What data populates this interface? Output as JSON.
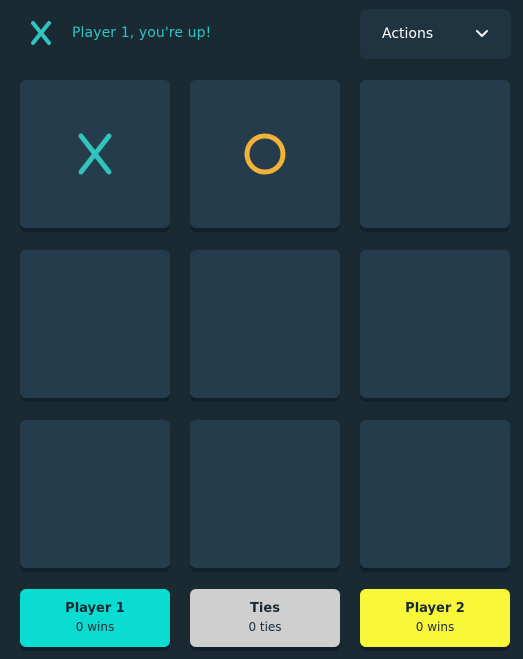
{
  "header": {
    "turn_mark": "X",
    "turn_text": "Player 1, you're up!",
    "actions_label": "Actions"
  },
  "board": {
    "cells": [
      "X",
      "O",
      "",
      "",
      "",
      "",
      "",
      "",
      ""
    ]
  },
  "scores": {
    "player1": {
      "title": "Player 1",
      "value": "0 wins"
    },
    "ties": {
      "title": "Ties",
      "value": "0 ties"
    },
    "player2": {
      "title": "Player 2",
      "value": "0 wins"
    }
  },
  "colors": {
    "background": "#1a2a33",
    "x": "#31c3bd",
    "o": "#f2b137",
    "player1_score": "#0bdcd2",
    "ties_score": "#cfcfcf",
    "player2_score": "#f9f73a"
  }
}
